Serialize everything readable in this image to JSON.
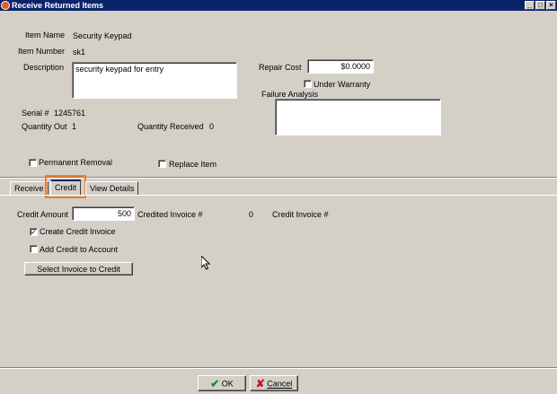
{
  "window": {
    "title": "Receive Returned Items"
  },
  "item": {
    "name_label": "Item Name",
    "name_value": "Security Keypad",
    "number_label": "Item Number",
    "number_value": "sk1",
    "description_label": "Description",
    "description_value": "security keypad for entry",
    "serial_label": "Serial #",
    "serial_value": "1245761",
    "qty_out_label": "Quantity Out",
    "qty_out_value": "1",
    "qty_received_label": "Quantity Received",
    "qty_received_value": "0"
  },
  "repair": {
    "cost_label": "Repair Cost",
    "cost_value": "$0.0000",
    "under_warranty_label": "Under Warranty",
    "under_warranty_checked": false,
    "failure_label": "Failure Analysis",
    "failure_value": ""
  },
  "options": {
    "permanent_removal_label": "Permanent Removal",
    "permanent_removal_checked": false,
    "replace_item_label": "Replace Item",
    "replace_item_checked": false
  },
  "tabs": [
    {
      "label": "Receive",
      "active": false
    },
    {
      "label": "Credit",
      "active": true
    },
    {
      "label": "View Details",
      "active": false
    }
  ],
  "credit": {
    "amount_label": "Credit Amount",
    "amount_value": "500",
    "credited_invoice_label": "Credited Invoice #",
    "credited_invoice_value": "0",
    "credit_invoice_label": "Credit Invoice #",
    "create_credit_invoice_label": "Create Credit Invoice",
    "create_credit_invoice_checked": true,
    "add_credit_label": "Add Credit to Account",
    "add_credit_checked": false,
    "select_invoice_label": "Select Invoice to Credit"
  },
  "footer": {
    "ok_label": "OK",
    "cancel_label": "Cancel"
  }
}
